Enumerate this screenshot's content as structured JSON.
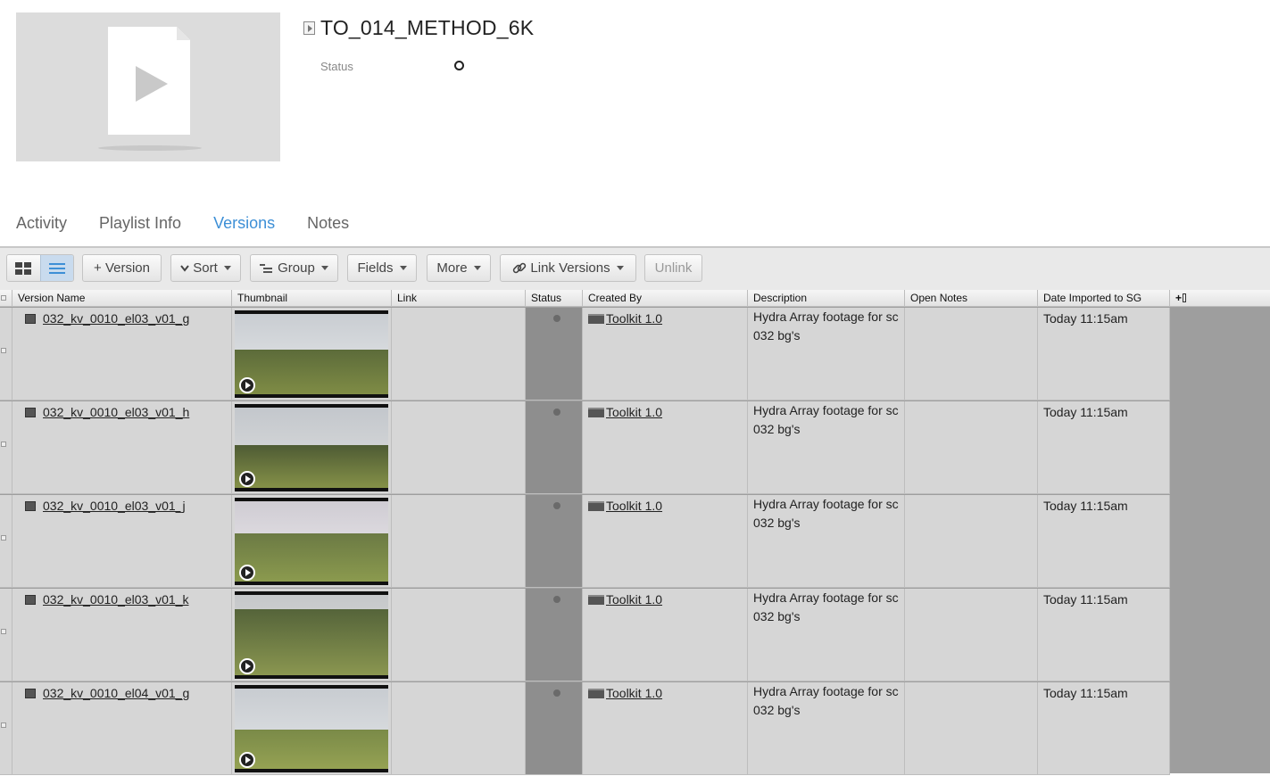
{
  "header": {
    "title": "TO_014_METHOD_6K",
    "status_label": "Status"
  },
  "tabs": [
    {
      "label": "Activity",
      "active": false
    },
    {
      "label": "Playlist Info",
      "active": false
    },
    {
      "label": "Versions",
      "active": true
    },
    {
      "label": "Notes",
      "active": false
    }
  ],
  "toolbar": {
    "add_version": "+ Version",
    "sort": "Sort",
    "group": "Group",
    "fields": "Fields",
    "more": "More",
    "link_versions": "Link Versions",
    "unlink": "Unlink"
  },
  "columns": [
    "Version Name",
    "Thumbnail",
    "Link",
    "Status",
    "Created By",
    "Description",
    "Open Notes",
    "Date Imported to SG"
  ],
  "add_column_glyph": "+",
  "rows": [
    {
      "version_name": "032_kv_0010_el03_v01_g",
      "link": "",
      "created_by": "Toolkit 1.0",
      "description_1": "Hydra Array footage for sc",
      "description_2": "032 bg's",
      "open_notes": "",
      "date_imported": "Today 11:15am"
    },
    {
      "version_name": "032_kv_0010_el03_v01_h",
      "link": "",
      "created_by": "Toolkit 1.0",
      "description_1": "Hydra Array footage for sc",
      "description_2": "032 bg's",
      "open_notes": "",
      "date_imported": "Today 11:15am"
    },
    {
      "version_name": "032_kv_0010_el03_v01_j",
      "link": "",
      "created_by": "Toolkit 1.0",
      "description_1": "Hydra Array footage for sc",
      "description_2": "032 bg's",
      "open_notes": "",
      "date_imported": "Today 11:15am"
    },
    {
      "version_name": "032_kv_0010_el03_v01_k",
      "link": "",
      "created_by": "Toolkit 1.0",
      "description_1": "Hydra Array footage for sc",
      "description_2": "032 bg's",
      "open_notes": "",
      "date_imported": "Today 11:15am"
    },
    {
      "version_name": "032_kv_0010_el04_v01_g",
      "link": "",
      "created_by": "Toolkit 1.0",
      "description_1": "Hydra Array footage for sc",
      "description_2": "032 bg's",
      "open_notes": "",
      "date_imported": "Today 11:15am"
    }
  ],
  "colors": {
    "accent": "#3d8fd6",
    "row_bg": "#d6d6d6",
    "status_col_bg": "#8e8e8e",
    "grid_empty": "#9e9e9e"
  },
  "icons": [
    "play-icon",
    "file-icon",
    "grid-view-icon",
    "list-view-icon",
    "sort-icon",
    "group-icon",
    "link-icon",
    "version-icon",
    "toolkit-icon"
  ]
}
